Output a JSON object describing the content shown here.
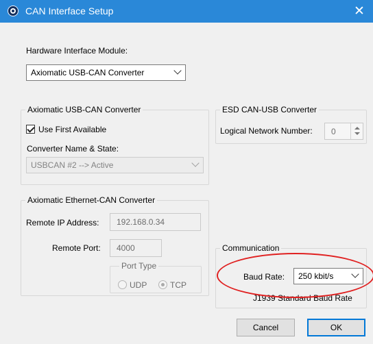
{
  "window": {
    "title": "CAN Interface Setup",
    "close_glyph": "✕"
  },
  "hardware": {
    "label": "Hardware Interface Module:",
    "selected": "Axiomatic USB-CAN Converter"
  },
  "usb_can": {
    "group_title": "Axiomatic USB-CAN Converter",
    "use_first_available": {
      "label": "Use First Available",
      "checked": true
    },
    "converter_label": "Converter Name & State:",
    "converter_value": "USBCAN #2  --> Active"
  },
  "esd": {
    "group_title": "ESD CAN-USB Converter",
    "logical_network_label": "Logical Network Number:",
    "logical_network_value": "0"
  },
  "ethernet": {
    "group_title": "Axiomatic Ethernet-CAN Converter",
    "remote_ip_label": "Remote IP Address:",
    "remote_ip_value": "192.168.0.34",
    "remote_port_label": "Remote Port:",
    "remote_port_value": "4000",
    "port_type": {
      "title": "Port Type",
      "udp_label": "UDP",
      "tcp_label": "TCP",
      "selected": "TCP"
    }
  },
  "communication": {
    "group_title": "Communication",
    "baud_rate_label": "Baud Rate:",
    "baud_rate_value": "250 kbit/s",
    "baud_note": "J1939 Standard Baud Rate",
    "annotation_color": "#e02121"
  },
  "buttons": {
    "cancel": "Cancel",
    "ok": "OK"
  },
  "colors": {
    "titlebar": "#2a88d8",
    "default_button_border": "#0078d7"
  }
}
